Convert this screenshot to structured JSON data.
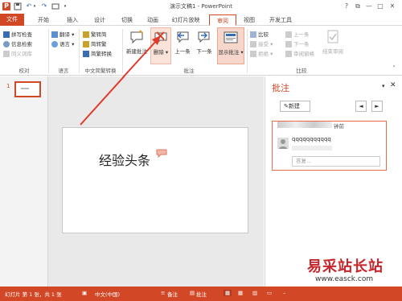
{
  "window": {
    "title": "演示文稿1 - PowerPoint",
    "help": "?",
    "restore": "⧉",
    "minimize": "—",
    "maximize": "□",
    "close": "✕"
  },
  "tabs": [
    {
      "label": "文件"
    },
    {
      "label": "开始"
    },
    {
      "label": "插入"
    },
    {
      "label": "设计"
    },
    {
      "label": "切换"
    },
    {
      "label": "动画"
    },
    {
      "label": "幻灯片放映"
    },
    {
      "label": "审阅"
    },
    {
      "label": "视图"
    },
    {
      "label": "开发工具"
    }
  ],
  "ribbon": {
    "proofing": {
      "spellcheck": "拼写检查",
      "research": "信息检索",
      "thesaurus": "同义词库",
      "label": "校对"
    },
    "language": {
      "translate": "翻译",
      "language": "语言",
      "label": "语言"
    },
    "chinese": {
      "to_simplified": "繁转简",
      "to_traditional": "简转繁",
      "convert": "简繁转换",
      "label": "中文简繁转换"
    },
    "comments": {
      "new": "新建批注",
      "delete": "删除",
      "prev": "上一条",
      "next": "下一条",
      "show": "显示批注",
      "label": "批注"
    },
    "compare": {
      "compare": "比较",
      "accept": "接受",
      "reject": "拒绝",
      "prev": "上一条",
      "next": "下一条",
      "reviewing_pane": "审阅窗格",
      "end": "结束审阅",
      "label": "比较"
    }
  },
  "thumbnail": {
    "number": "1"
  },
  "slide": {
    "text": "经验头条"
  },
  "comment_pane": {
    "title": "批注",
    "new_button": "新建",
    "time": "钟前",
    "comment_text": "qqqqqqqqqqq",
    "reply_placeholder": "答复..."
  },
  "status": {
    "slide_info": "幻灯片 第 1 张，共 1 张",
    "language": "中文(中国)",
    "notes": "备注",
    "comments": "批注",
    "zoom": "–"
  },
  "watermark": {
    "text": "易采站长站",
    "url": "www.easck.com"
  },
  "colors": {
    "accent": "#d24726",
    "accent_light": "#f7d7cc",
    "comment_highlight": "#f2b6a8"
  }
}
